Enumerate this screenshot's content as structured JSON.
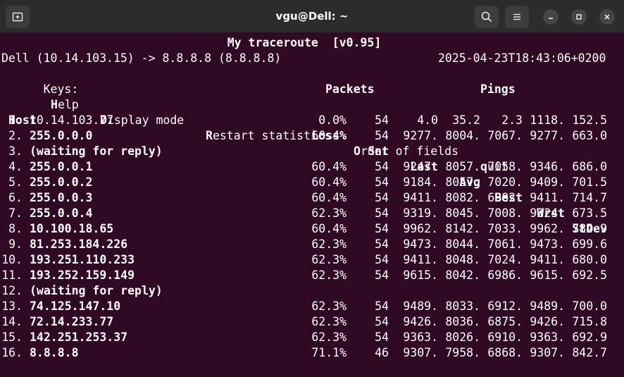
{
  "window": {
    "title": "vgu@Dell: ~",
    "icons": {
      "new_tab": "new-tab-icon",
      "search": "search-icon",
      "menu": "hamburger-menu-icon",
      "minimize": "minimize-icon",
      "maximize": "maximize-icon",
      "close": "close-icon"
    }
  },
  "terminal": {
    "app_title": "My traceroute  [v0.95]",
    "route_info": "Dell (10.14.103.15) -> 8.8.8.8 (8.8.8.8)",
    "timestamp": "2025-04-23T18:43:06+0200",
    "keys": [
      {
        "label": "Keys:",
        "key": "",
        "rest": ""
      },
      {
        "label": "",
        "key": "H",
        "rest": "elp"
      },
      {
        "label": "",
        "key": "D",
        "rest": "isplay mode"
      },
      {
        "label": "",
        "key": "R",
        "rest": "estart statistics"
      },
      {
        "label": "",
        "key": "O",
        "rest": "rder of fields"
      },
      {
        "label": "",
        "key": "q",
        "rest": "uit"
      }
    ],
    "group_headers": {
      "packets": "Packets",
      "pings": "Pings"
    },
    "columns": {
      "host": "Host",
      "loss": "Loss%",
      "snt": "Snt",
      "last": "Last",
      "avg": "Avg",
      "best": "Best",
      "wrst": "Wrst",
      "stdev": "StDev"
    },
    "hops": [
      {
        "num": "1.",
        "host": "10.14.103.77",
        "bold": false,
        "loss": "0.0%",
        "snt": "54",
        "last": "4.0",
        "avg": "35.2",
        "best": "2.3",
        "wrst": "1118.",
        "stdev": "152.5"
      },
      {
        "num": "2.",
        "host": "255.0.0.0",
        "bold": true,
        "loss": "60.4%",
        "snt": "54",
        "last": "9277.",
        "avg": "8004.",
        "best": "7067.",
        "wrst": "9277.",
        "stdev": "663.0"
      },
      {
        "num": "3.",
        "host": "(waiting for reply)",
        "bold": true,
        "loss": "",
        "snt": "",
        "last": "",
        "avg": "",
        "best": "",
        "wrst": "",
        "stdev": ""
      },
      {
        "num": "4.",
        "host": "255.0.0.1",
        "bold": true,
        "loss": "60.4%",
        "snt": "54",
        "last": "9247.",
        "avg": "8057.",
        "best": "7058.",
        "wrst": "9346.",
        "stdev": "686.0"
      },
      {
        "num": "5.",
        "host": "255.0.0.2",
        "bold": true,
        "loss": "60.4%",
        "snt": "54",
        "last": "9184.",
        "avg": "8057.",
        "best": "7020.",
        "wrst": "9409.",
        "stdev": "701.5"
      },
      {
        "num": "6.",
        "host": "255.0.0.3",
        "bold": true,
        "loss": "60.4%",
        "snt": "54",
        "last": "9411.",
        "avg": "8082.",
        "best": "6982.",
        "wrst": "9411.",
        "stdev": "714.7"
      },
      {
        "num": "7.",
        "host": "255.0.0.4",
        "bold": true,
        "loss": "62.3%",
        "snt": "54",
        "last": "9319.",
        "avg": "8045.",
        "best": "7008.",
        "wrst": "9324.",
        "stdev": "673.5"
      },
      {
        "num": "8.",
        "host": "10.100.18.65",
        "bold": true,
        "loss": "60.4%",
        "snt": "54",
        "last": "9962.",
        "avg": "8142.",
        "best": "7033.",
        "wrst": "9962.",
        "stdev": "784.9"
      },
      {
        "num": "9.",
        "host": "81.253.184.226",
        "bold": true,
        "loss": "62.3%",
        "snt": "54",
        "last": "9473.",
        "avg": "8044.",
        "best": "7061.",
        "wrst": "9473.",
        "stdev": "699.6"
      },
      {
        "num": "10.",
        "host": "193.251.110.233",
        "bold": true,
        "loss": "62.3%",
        "snt": "54",
        "last": "9411.",
        "avg": "8048.",
        "best": "7024.",
        "wrst": "9411.",
        "stdev": "680.0"
      },
      {
        "num": "11.",
        "host": "193.252.159.149",
        "bold": true,
        "loss": "62.3%",
        "snt": "54",
        "last": "9615.",
        "avg": "8042.",
        "best": "6986.",
        "wrst": "9615.",
        "stdev": "692.5"
      },
      {
        "num": "12.",
        "host": "(waiting for reply)",
        "bold": true,
        "loss": "",
        "snt": "",
        "last": "",
        "avg": "",
        "best": "",
        "wrst": "",
        "stdev": ""
      },
      {
        "num": "13.",
        "host": "74.125.147.10",
        "bold": true,
        "loss": "62.3%",
        "snt": "54",
        "last": "9489.",
        "avg": "8033.",
        "best": "6912.",
        "wrst": "9489.",
        "stdev": "700.0"
      },
      {
        "num": "14.",
        "host": "72.14.233.77",
        "bold": true,
        "loss": "62.3%",
        "snt": "54",
        "last": "9426.",
        "avg": "8036.",
        "best": "6875.",
        "wrst": "9426.",
        "stdev": "715.8"
      },
      {
        "num": "15.",
        "host": "142.251.253.37",
        "bold": true,
        "loss": "62.3%",
        "snt": "54",
        "last": "9363.",
        "avg": "8026.",
        "best": "6910.",
        "wrst": "9363.",
        "stdev": "692.9"
      },
      {
        "num": "16.",
        "host": "8.8.8.8",
        "bold": true,
        "loss": "71.1%",
        "snt": "46",
        "last": "9307.",
        "avg": "7958.",
        "best": "6868.",
        "wrst": "9307.",
        "stdev": "842.7"
      }
    ]
  },
  "colors": {
    "terminal_bg": "#300a24",
    "titlebar_bg": "#2c2c2c",
    "text": "#ffffff"
  }
}
